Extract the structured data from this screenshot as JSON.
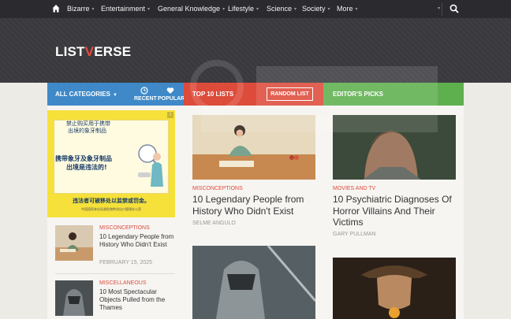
{
  "nav": {
    "items": [
      {
        "label": "Bizarre"
      },
      {
        "label": "Entertainment"
      },
      {
        "label": "General Knowledge"
      },
      {
        "label": "Lifestyle"
      },
      {
        "label": "Science"
      },
      {
        "label": "Society"
      },
      {
        "label": "More"
      }
    ],
    "caret": "▾"
  },
  "logo": {
    "pre": "LIST",
    "accent": "V",
    "post": "ERSE"
  },
  "categories": {
    "all_label": "ALL CATEGORIES",
    "all_caret": "▼",
    "recent_label": "RECENT",
    "popular_label": "POPULAR",
    "top_label": "TOP 10 LISTS",
    "random_label": "RANDOM LIST",
    "editor_label": "EDITOR'S PICKS"
  },
  "ad": {
    "badge": "i",
    "line1": "禁止购买用于携带",
    "line2": "出境的象牙制品",
    "line3": "携带象牙及象牙制品",
    "line4": "出境是违法的!",
    "line5": "违法者可被移处以监禁或罚金。",
    "line6": "中国国家林业局濒危物种进出口管理办公室"
  },
  "side": [
    {
      "category": "MISCONCEPTIONS",
      "title": "10 Legendary People from History Who Didn't Exist",
      "date": "FEBRUARY 15, 2025"
    },
    {
      "category": "MISCELLANEOUS",
      "title": "10 Most Spectacular Objects Pulled from the Thames",
      "date": ""
    }
  ],
  "main": [
    {
      "category": "MISCONCEPTIONS",
      "title": "10 Legendary People from History Who Didn't Exist",
      "author": "SELME ANGULO"
    },
    {
      "category": "MOVIES AND TV",
      "title": "10 Psychiatric Diagnoses Of Horror Villains And Their Victims",
      "author": "GARY PULLMAN"
    }
  ],
  "colors": {
    "all_categories": "#3f89c8",
    "top_lists": "#dd4b3b",
    "editors_picks": "#5eb04e",
    "category_text": "#dd4b3b"
  },
  "icons": [
    "home-icon",
    "search-icon",
    "clock-icon",
    "heart-icon"
  ]
}
